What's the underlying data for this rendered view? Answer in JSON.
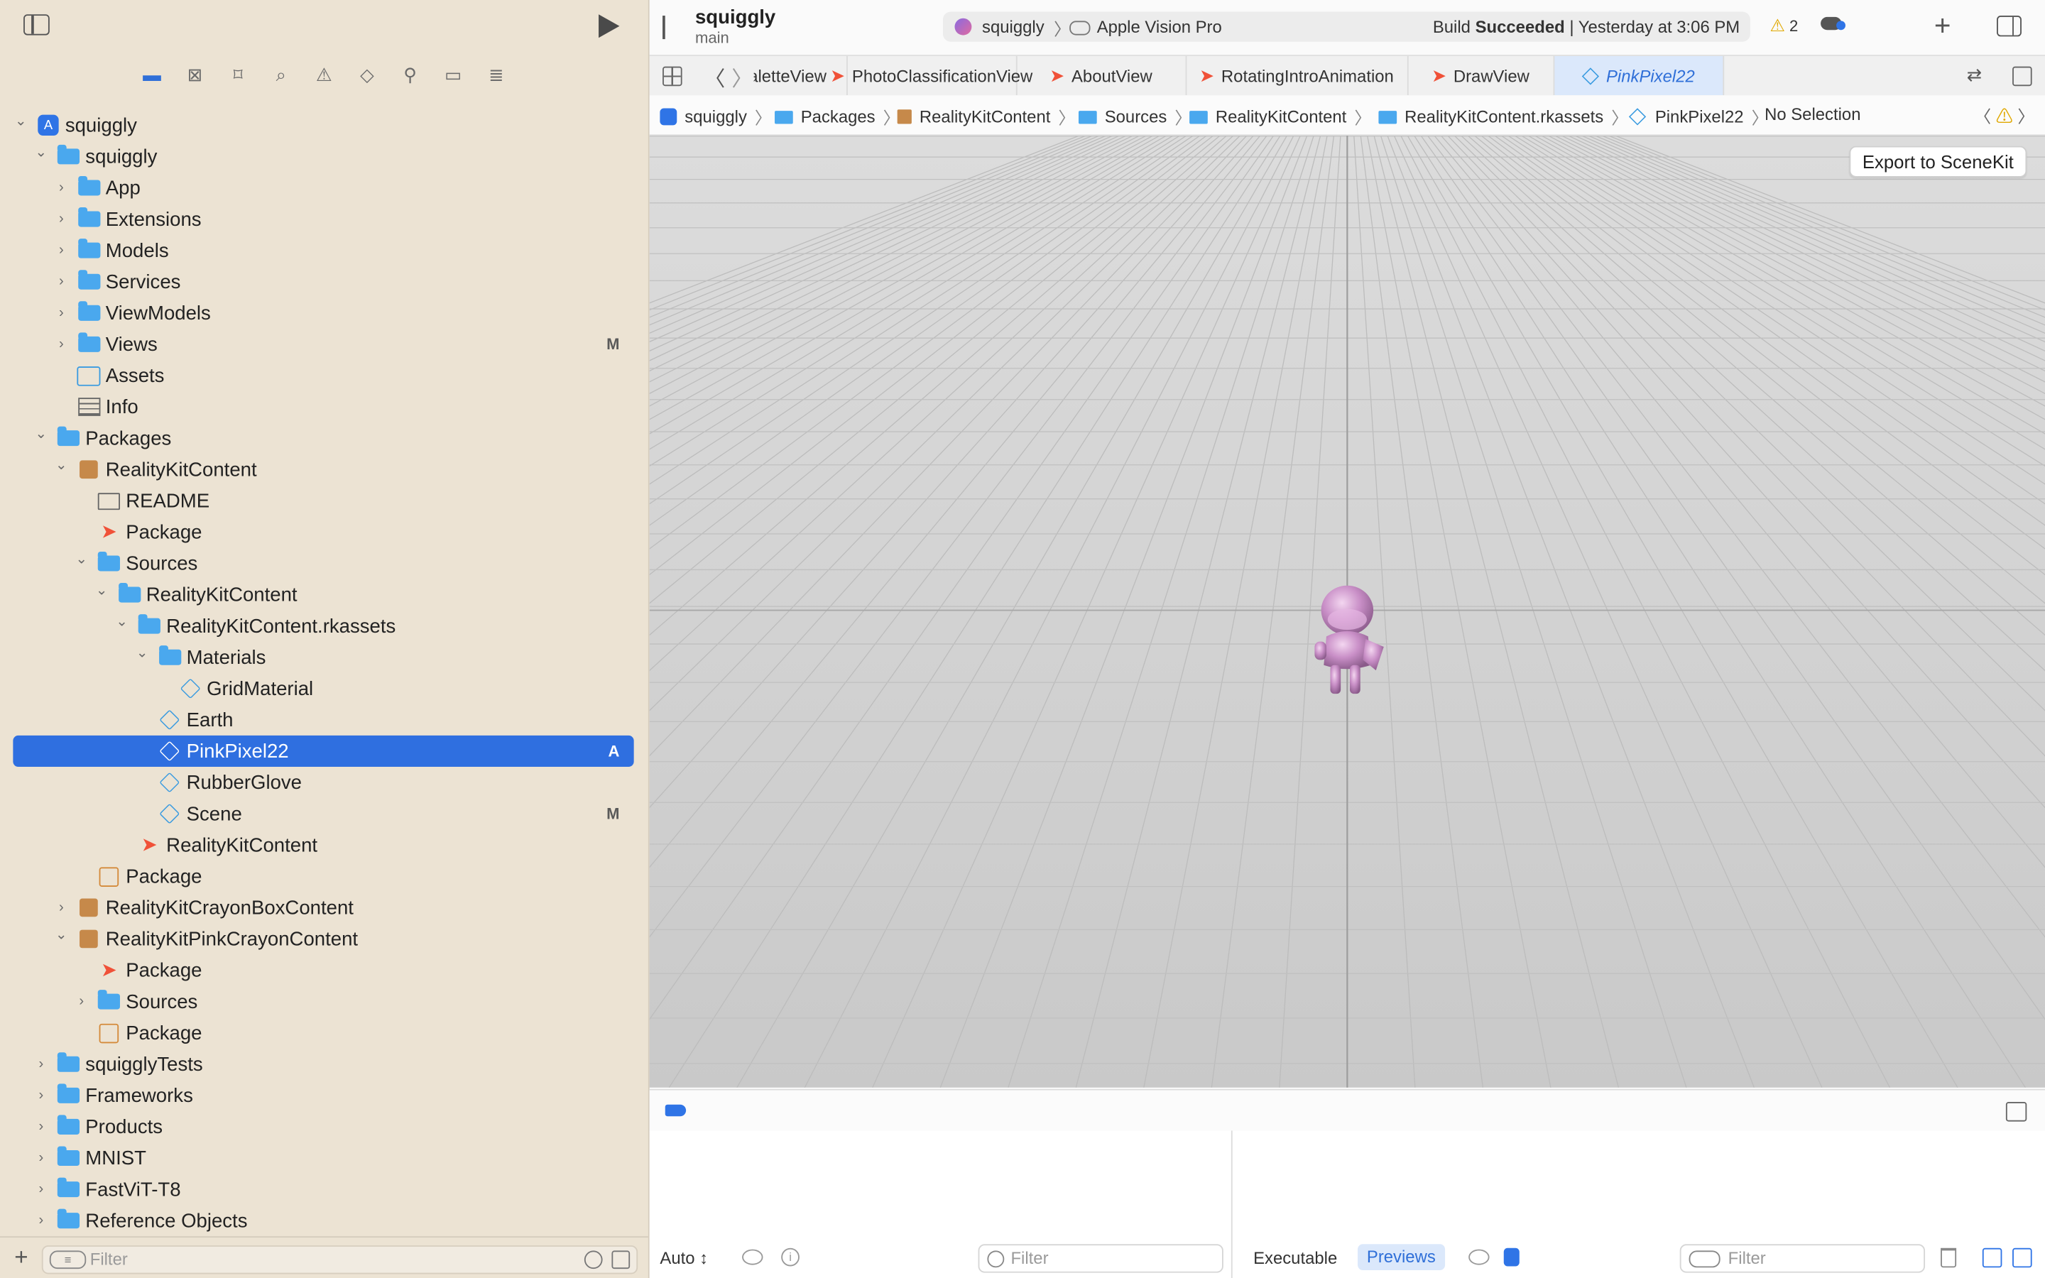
{
  "sidebar": {
    "filter_placeholder": "Filter",
    "nav_tabs": [
      "folder-icon",
      "xmark-square-icon",
      "bookmark-icon",
      "search-icon",
      "warning-icon",
      "diamond-icon",
      "spray-icon",
      "tag-icon",
      "report-icon"
    ],
    "tree": [
      {
        "label": "squiggly",
        "depth": 0,
        "icon": "app",
        "chev": "open"
      },
      {
        "label": "squiggly",
        "depth": 1,
        "icon": "folder",
        "chev": "open"
      },
      {
        "label": "App",
        "depth": 2,
        "icon": "folder",
        "chev": "closed"
      },
      {
        "label": "Extensions",
        "depth": 2,
        "icon": "folder",
        "chev": "closed"
      },
      {
        "label": "Models",
        "depth": 2,
        "icon": "folder",
        "chev": "closed"
      },
      {
        "label": "Services",
        "depth": 2,
        "icon": "folder",
        "chev": "closed"
      },
      {
        "label": "ViewModels",
        "depth": 2,
        "icon": "folder",
        "chev": "closed"
      },
      {
        "label": "Views",
        "depth": 2,
        "icon": "folder",
        "chev": "closed",
        "badge": "M"
      },
      {
        "label": "Assets",
        "depth": 2,
        "icon": "assets"
      },
      {
        "label": "Info",
        "depth": 2,
        "icon": "table"
      },
      {
        "label": "Packages",
        "depth": 1,
        "icon": "folder",
        "chev": "open"
      },
      {
        "label": "RealityKitContent",
        "depth": 2,
        "icon": "pkg",
        "chev": "open"
      },
      {
        "label": "README",
        "depth": 3,
        "icon": "book"
      },
      {
        "label": "Package",
        "depth": 3,
        "icon": "swift"
      },
      {
        "label": "Sources",
        "depth": 3,
        "icon": "folder",
        "chev": "open"
      },
      {
        "label": "RealityKitContent",
        "depth": 4,
        "icon": "folder",
        "chev": "open"
      },
      {
        "label": "RealityKitContent.rkassets",
        "depth": 5,
        "icon": "folder",
        "chev": "open"
      },
      {
        "label": "Materials",
        "depth": 6,
        "icon": "folder",
        "chev": "open"
      },
      {
        "label": "GridMaterial",
        "depth": 7,
        "icon": "cube"
      },
      {
        "label": "Earth",
        "depth": 6,
        "icon": "cube"
      },
      {
        "label": "PinkPixel22",
        "depth": 6,
        "icon": "cube",
        "badge": "A",
        "selected": true
      },
      {
        "label": "RubberGlove",
        "depth": 6,
        "icon": "cube"
      },
      {
        "label": "Scene",
        "depth": 6,
        "icon": "cube",
        "badge": "M"
      },
      {
        "label": "RealityKitContent",
        "depth": 5,
        "icon": "swift"
      },
      {
        "label": "Package",
        "depth": 3,
        "icon": "pkg-o"
      },
      {
        "label": "RealityKitCrayonBoxContent",
        "depth": 2,
        "icon": "pkg",
        "chev": "closed"
      },
      {
        "label": "RealityKitPinkCrayonContent",
        "depth": 2,
        "icon": "pkg",
        "chev": "open"
      },
      {
        "label": "Package",
        "depth": 3,
        "icon": "swift"
      },
      {
        "label": "Sources",
        "depth": 3,
        "icon": "folder",
        "chev": "closed"
      },
      {
        "label": "Package",
        "depth": 3,
        "icon": "pkg-o"
      },
      {
        "label": "squigglyTests",
        "depth": 1,
        "icon": "folder",
        "chev": "closed"
      },
      {
        "label": "Frameworks",
        "depth": 1,
        "icon": "folder",
        "chev": "closed"
      },
      {
        "label": "Products",
        "depth": 1,
        "icon": "folder",
        "chev": "closed"
      },
      {
        "label": "MNIST",
        "depth": 1,
        "icon": "folder",
        "chev": "closed"
      },
      {
        "label": "FastViT-T8",
        "depth": 1,
        "icon": "folder",
        "chev": "closed"
      },
      {
        "label": "Reference Objects",
        "depth": 1,
        "icon": "folder",
        "chev": "closed"
      }
    ]
  },
  "toolbar": {
    "project": "squiggly",
    "branch": "main",
    "scheme": "squiggly",
    "destination": "Apple Vision Pro",
    "status_prefix": "Build",
    "status_bold": "Succeeded",
    "status_suffix": "| Yesterday at 3:06 PM",
    "warnings": "2"
  },
  "tabs": [
    {
      "label": "PaletteView",
      "kind": "swift"
    },
    {
      "label": "PhotoClassificationView",
      "kind": "swift"
    },
    {
      "label": "AboutView",
      "kind": "swift"
    },
    {
      "label": "RotatingIntroAnimation",
      "kind": "swift"
    },
    {
      "label": "DrawView",
      "kind": "swift"
    },
    {
      "label": "PinkPixel22",
      "kind": "cube",
      "active": true
    }
  ],
  "jumpbar": [
    {
      "label": "squiggly",
      "icon": "app"
    },
    {
      "label": "Packages",
      "icon": "folder"
    },
    {
      "label": "RealityKitContent",
      "icon": "pkg"
    },
    {
      "label": "Sources",
      "icon": "folder"
    },
    {
      "label": "RealityKitContent",
      "icon": "folder"
    },
    {
      "label": "RealityKitContent.rkassets",
      "icon": "folder"
    },
    {
      "label": "PinkPixel22",
      "icon": "cube"
    },
    {
      "label": "No Selection",
      "icon": ""
    }
  ],
  "viewport": {
    "export_label": "Export to SceneKit"
  },
  "bottom": {
    "auto_label": "Auto ↕",
    "filter_left": "Filter",
    "executable_label": "Executable",
    "previews_label": "Previews",
    "filter_right": "Filter"
  }
}
